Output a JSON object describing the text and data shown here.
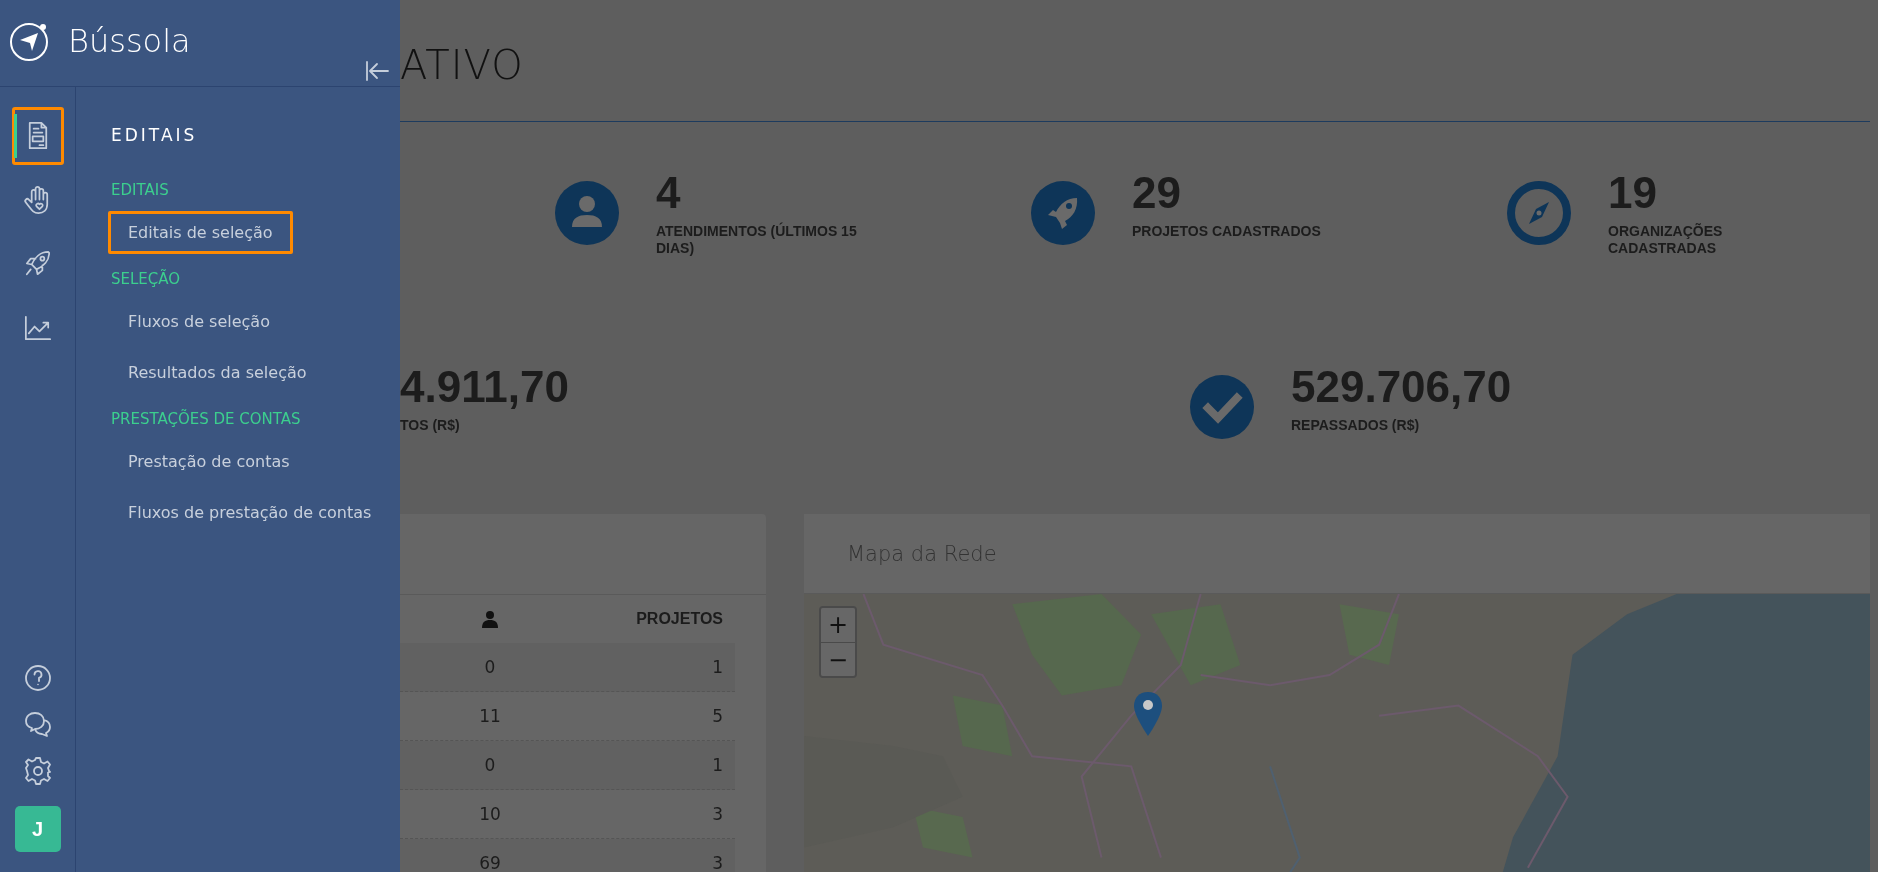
{
  "sidebar": {
    "brand": "Bússola",
    "rail": [
      {
        "selected": true,
        "highlighted": true
      },
      {
        "selected": false,
        "highlighted": false
      },
      {
        "selected": false,
        "highlighted": false
      },
      {
        "selected": false,
        "highlighted": false
      }
    ],
    "user_initial": "J",
    "menu": {
      "title": "EDITAIS",
      "groups": [
        {
          "label": "EDITAIS",
          "items": [
            {
              "label": "Editais de seleção",
              "highlighted": true
            }
          ]
        },
        {
          "label": "SELEÇÃO",
          "items": [
            {
              "label": "Fluxos de seleção",
              "highlighted": false
            },
            {
              "label": "Resultados da seleção",
              "highlighted": false
            }
          ]
        },
        {
          "label": "PRESTAÇÕES DE CONTAS",
          "items": [
            {
              "label": "Prestação de contas",
              "highlighted": false
            },
            {
              "label": "Fluxos de prestação de contas",
              "highlighted": false
            }
          ]
        }
      ]
    }
  },
  "dashboard": {
    "title": "ATIVO",
    "stats": [
      {
        "kind": "person",
        "value": "4",
        "label": "ATENDIMENTOS (ÚLTIMOS 15 DIAS)"
      },
      {
        "kind": "rocket",
        "value": "29",
        "label": "PROJETOS CADASTRADOS"
      },
      {
        "kind": "compass",
        "value": "19",
        "label": "ORGANIZAÇÕES CADASTRADAS"
      }
    ],
    "totals": [
      {
        "kind": "plain",
        "value": "4.911,70",
        "label": "TOS (R$)"
      },
      {
        "kind": "check",
        "value": "529.706,70",
        "label": "REPASSADOS (R$)"
      }
    ],
    "table": {
      "column_2": "PROJETOS",
      "rows": [
        [
          "0",
          "1"
        ],
        [
          "11",
          "5"
        ],
        [
          "0",
          "1"
        ],
        [
          "10",
          "3"
        ],
        [
          "69",
          "3"
        ]
      ]
    },
    "map": {
      "title": "Mapa da Rede",
      "zoom_in": "+",
      "zoom_out": "−"
    }
  }
}
